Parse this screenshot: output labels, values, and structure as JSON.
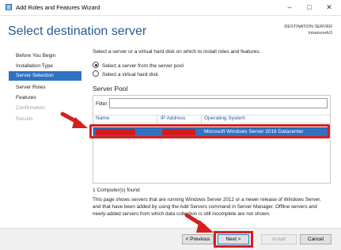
{
  "window": {
    "title": "Add Roles and Features Wizard",
    "minimize": "–",
    "maximize": "□",
    "close": "✕"
  },
  "header": {
    "page_title": "Select destination server",
    "destination_label": "DESTINATION SERVER",
    "destination_value": "kmazuredv3"
  },
  "nav": {
    "items": [
      {
        "label": "Before You Begin",
        "state": "normal"
      },
      {
        "label": "Installation Type",
        "state": "normal"
      },
      {
        "label": "Server Selection",
        "state": "selected"
      },
      {
        "label": "Server Roles",
        "state": "normal"
      },
      {
        "label": "Features",
        "state": "normal"
      },
      {
        "label": "Confirmation",
        "state": "disabled"
      },
      {
        "label": "Results",
        "state": "disabled"
      }
    ]
  },
  "main": {
    "intro": "Select a server or a virtual hard disk on which to install roles and features.",
    "options": [
      {
        "label": "Select a server from the server pool",
        "checked": true
      },
      {
        "label": "Select a virtual hard disk",
        "checked": false
      }
    ],
    "pool_heading": "Server Pool",
    "filter_label": "Filter:",
    "filter_value": "",
    "columns": [
      "Name",
      "IP Address",
      "Operating System"
    ],
    "rows": [
      {
        "os": "Microsoft Windows Server 2016 Datacenter"
      }
    ],
    "count": "1 Computer(s) found",
    "description": "This page shows servers that are running Windows Server 2012 or a newer release of Windows Server, and that have been added by using the Add Servers command in Server Manager. Offline servers and newly-added servers from which data collection is still incomplete are not shown."
  },
  "footer": {
    "previous": "< Previous",
    "next": "Next >",
    "install": "Install",
    "cancel": "Cancel"
  },
  "colors": {
    "accent": "#2e72c2",
    "title": "#2b5797",
    "annotation": "#d42020"
  }
}
